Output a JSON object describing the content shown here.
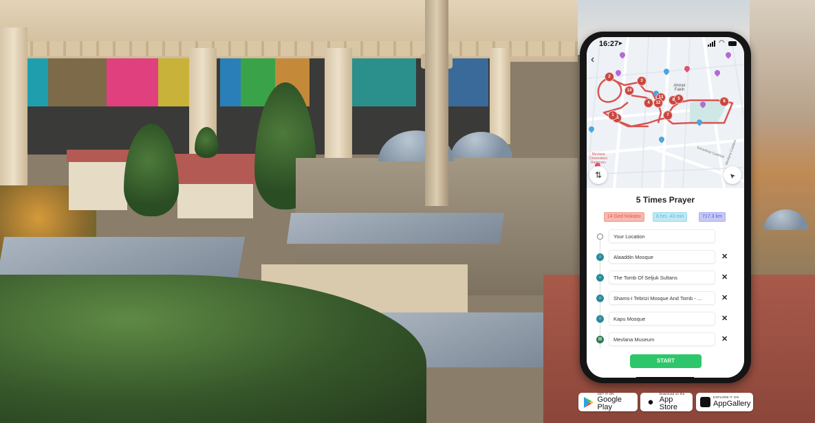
{
  "phone": {
    "status_bar": {
      "time": "16:27",
      "location_icon": "location-arrow-icon",
      "signal_icon": "cellular-signal-icon",
      "wifi_icon": "wifi-icon",
      "battery_icon": "battery-icon"
    },
    "map": {
      "back_icon": "‹",
      "route_toggle_icon": "⇅",
      "locate_icon": "➤",
      "labels": [
        "Ahmet Fakih",
        "Sarıyakup Caddesi",
        "Mevlana Caddesi",
        "Mevlana Üniversitesi Restoranı"
      ],
      "markers": [
        "2",
        "3",
        "14",
        "13",
        "4",
        "12",
        "9",
        "5",
        "8",
        "7",
        "11",
        "1"
      ],
      "route_color": "#d9534f"
    },
    "route": {
      "title": "5 Times Prayer",
      "chips": {
        "stops": "14 Ged Noktası",
        "duration": "8 hrs. 43 min",
        "distance": "717.3 km"
      },
      "stops": [
        {
          "name": "Your Location",
          "type": "start",
          "removable": false
        },
        {
          "name": "Alaaddin Mosque",
          "type": "mosque",
          "removable": true
        },
        {
          "name": "The Tomb Of Seljuk Sultans",
          "type": "mosque",
          "removable": true
        },
        {
          "name": "Shams-i Tebrizi Mosque And Tomb - ...",
          "type": "mosque",
          "removable": true
        },
        {
          "name": "Kapu Mosque",
          "type": "mosque",
          "removable": true
        },
        {
          "name": "Mevlana Museum",
          "type": "museum",
          "removable": true
        }
      ],
      "remove_icon": "✕",
      "start_button": "START"
    }
  },
  "store_badges": [
    {
      "small": "GET IT ON",
      "big": "Google Play",
      "icon": "google-play-icon"
    },
    {
      "small": "Download on the",
      "big": "App Store",
      "icon": "apple-icon"
    },
    {
      "small": "EXPLORE IT ON",
      "big": "AppGallery",
      "icon": "huawei-icon"
    }
  ],
  "colors": {
    "start_green": "#2ec66a",
    "stop_icon_teal": "#2a8a9a",
    "museum_green": "#2f7a52",
    "chip_red": "#e0584a",
    "chip_blue": "#56b8d6",
    "chip_purple": "#5860d6"
  }
}
